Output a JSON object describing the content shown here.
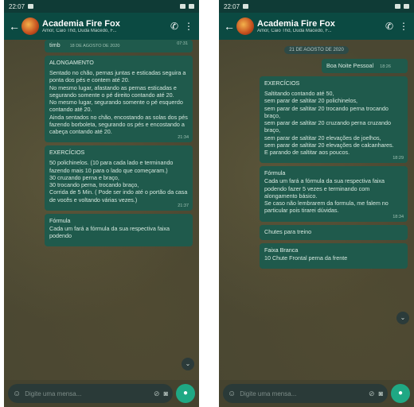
{
  "status": {
    "time": "22:07"
  },
  "chat": {
    "title": "Academia Fire Fox",
    "subtitle_left": "Amor, Caio Thd, Duda Macedo, F...",
    "subtitle_right": "Amor, Caio Thd, Duda Macedo, F..."
  },
  "left": {
    "top_fragment": "timb",
    "top_fragment_date": "18 DE AGOSTO DE 2020",
    "top_fragment_time": "07:31",
    "alongamento": {
      "head": "ALONGAMENTO",
      "body": "Sentado no chão, pernas juntas e esticadas seguira a ponta dos pés e contem até 20.\nNo mesmo lugar, afastando as pernas esticadas e segurando somente o pé direito contando até 20.\nNo mesmo lugar, segurando somente o pé esquerdo contando até 20.\nAinda sentados no chão, encostando as solas dos pés fazendo borboleta, segurando os pés e encostando a cabeça contando até 20.",
      "time": "21:34"
    },
    "exercicios": {
      "head": "EXERCÍCIOS",
      "body": "50 polichinelos. (10 para cada lado e terminando fazendo mais 10 para o lado que começaram.)\n30 cruzando perna e braço,\n30 trocando perna, trocando braço,\nCorrida de 5 Min. ( Pode ser indo até o portão da casa de vocês e voltando várias vezes.)",
      "time": "21:37"
    },
    "formula": {
      "head": "Fórmula",
      "body": "Cada um fará a fórmula da sua respectiva faixa podendo"
    }
  },
  "right": {
    "date_chip": "21 DE AGOSTO DE 2020",
    "greeting": {
      "text": "Boa Noite Pessoal",
      "time": "18:26"
    },
    "exercicios": {
      "head": "EXERCÍCIOS",
      "body": "Saltitando contando até 50,\nsem parar de saltitar 20 polichinelos,\nsem parar de saltitar 20 trocando perna trocando braço,\nsem parar de saltitar 20 cruzando perna cruzando braço,\nsem parar de saltitar 20 elevações de joelhos,\nsem parar de saltitar 20 elevações de calcanhares.\nE parando de saltitar aos poucos.",
      "time": "18:29"
    },
    "formula": {
      "head": "Fórmula",
      "body": "Cada um fará a fórmula da sua respectiva faixa podendo fazer 5 vezes e terminando com alongamento básico.\nSe caso não lembrarem da formula, me falem no particular pois tirarei dúvidas.",
      "time": "18:34"
    },
    "chutes": {
      "text": "Chutes para treino"
    },
    "faixa": {
      "head": "Faixa Branca",
      "body": "10 Chute Frontal perna da frente"
    }
  },
  "input": {
    "placeholder": "Digite uma mensa..."
  }
}
